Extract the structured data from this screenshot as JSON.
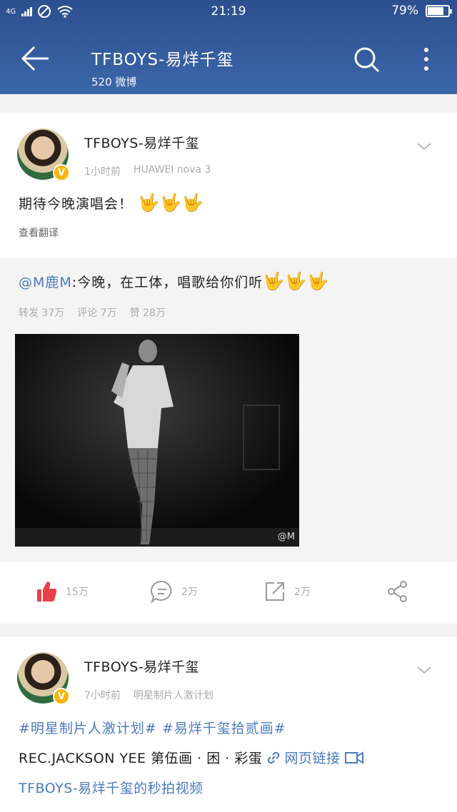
{
  "status_bar": {
    "network": "4G",
    "time": "21:19",
    "battery": "79%",
    "battery_level": 0.79
  },
  "header": {
    "title": "TFBOYS-易烊千玺",
    "subtitle": "520 微博"
  },
  "posts": [
    {
      "username": "TFBOYS-易烊千玺",
      "time": "1小时前",
      "device": "HUAWEI nova 3",
      "text": "期待今晚演唱会！",
      "emoji": "🤟🤟🤟",
      "translate_label": "查看翻译",
      "repost": {
        "mention": "@M鹿M",
        "text": ":今晚，在工体，唱歌给你们听",
        "emoji": "🤟🤟🤟",
        "stats": [
          "转发 37万",
          "评论 7万",
          "赞 28万"
        ],
        "watermark": "@M"
      },
      "actions": {
        "like_count": "15万",
        "comment_count": "2万",
        "share_count": "2万"
      }
    },
    {
      "username": "TFBOYS-易烊千玺",
      "time": "7小时前",
      "source": "明星制片人激计划",
      "tags": "#明星制片人激计划# #易烊千玺拾贰画#",
      "line2_text": "REC.JACKSON YEE 第伍画 · 困 · 彩蛋",
      "link_label": "网页链接",
      "line3_text": "TFBOYS-易烊千玺的秒拍视频"
    }
  ],
  "colors": {
    "header_bg": "#3b67a9",
    "link": "#4a7bbf",
    "like": "#e8404b"
  }
}
